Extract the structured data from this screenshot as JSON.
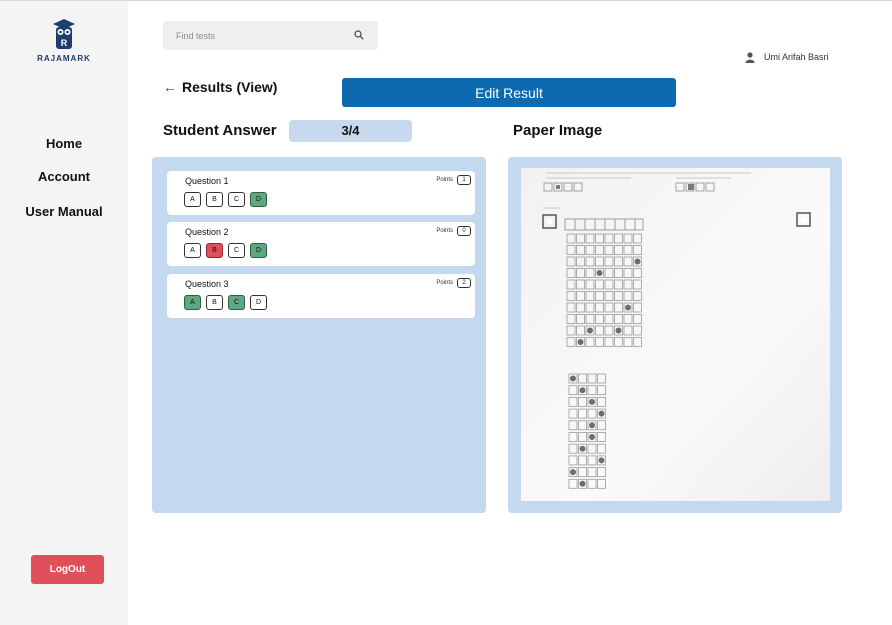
{
  "brand": {
    "name": "RAJAMARK"
  },
  "nav": {
    "items": [
      {
        "label": "Home"
      },
      {
        "label": "Account"
      },
      {
        "label": "User Manual"
      }
    ],
    "logout_label": "LogOut"
  },
  "search": {
    "placeholder": "Find tests",
    "value": ""
  },
  "user": {
    "name": "Umi Arifah Basri"
  },
  "header": {
    "back_label": "Results (View)",
    "edit_label": "Edit Result"
  },
  "student_answer": {
    "title": "Student Answer",
    "score": "3/4",
    "points_label": "Points",
    "questions": [
      {
        "title": "Question 1",
        "points": "1",
        "options": [
          "A",
          "B",
          "C",
          "D"
        ],
        "states": [
          "none",
          "none",
          "none",
          "correct"
        ]
      },
      {
        "title": "Question 2",
        "points": "0",
        "options": [
          "A",
          "B",
          "C",
          "D"
        ],
        "states": [
          "none",
          "wrong",
          "none",
          "correct"
        ]
      },
      {
        "title": "Question 3",
        "points": "2",
        "options": [
          "A",
          "B",
          "C",
          "D"
        ],
        "states": [
          "correct",
          "none",
          "correct",
          "none"
        ]
      }
    ]
  },
  "paper": {
    "title": "Paper Image"
  },
  "colors": {
    "primary": "#0e6ab0",
    "panel": "#c4d8ef",
    "correct": "#5fa77f",
    "wrong": "#e0505a",
    "logout": "#e0505a"
  },
  "icons": {
    "search": "search-icon",
    "user": "user-icon",
    "back": "arrow-left-icon",
    "logo": "owl-logo-icon"
  }
}
